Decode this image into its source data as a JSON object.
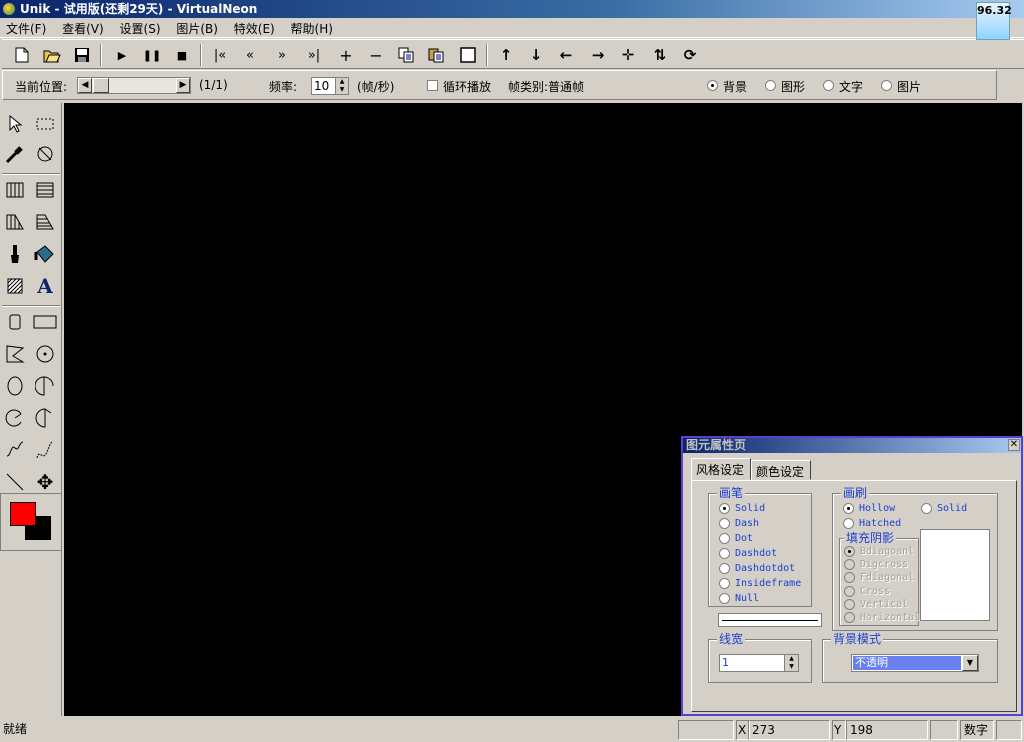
{
  "window": {
    "title": "Unik - 试用版(还剩29天) - VirtualNeon",
    "zoom_badge": "96.32"
  },
  "menu": [
    "文件(F)",
    "查看(V)",
    "设置(S)",
    "图片(B)",
    "特效(E)",
    "帮助(H)"
  ],
  "playbar": {
    "position_label": "当前位置:",
    "frame_count": "(1/1)",
    "rate_label": "频率:",
    "rate_value": "10",
    "rate_unit": "(帧/秒)",
    "loop_label": "循环播放",
    "frame_type": "帧类别:普通帧",
    "layers": [
      {
        "label": "背景",
        "selected": true
      },
      {
        "label": "图形",
        "selected": false
      },
      {
        "label": "文字",
        "selected": false
      },
      {
        "label": "图片",
        "selected": false
      }
    ]
  },
  "colors": {
    "foreground": "#ff0000",
    "background": "#000000",
    "canvas": "#000000"
  },
  "status": {
    "ready": "就绪",
    "x_label": "X",
    "x_value": "273",
    "y_label": "Y",
    "y_value": "198",
    "numlock": "数字"
  },
  "props": {
    "title": "图元属性页",
    "tabs": [
      "风格设定",
      "颜色设定"
    ],
    "pen": {
      "title": "画笔",
      "options": [
        "Solid",
        "Dash",
        "Dot",
        "Dashdot",
        "Dashdotdot",
        "Insideframe",
        "Null"
      ],
      "selected": "Solid"
    },
    "brush": {
      "title": "画刷",
      "options": [
        "Hollow",
        "Solid",
        "Hatched"
      ],
      "selected": "Hollow"
    },
    "hatch": {
      "title": "填充阴影",
      "options": [
        "Bdiagoanl",
        "Digcross",
        "Fdiagonal",
        "Cross",
        "Vertical",
        "Horizontal"
      ]
    },
    "line_width": {
      "title": "线宽",
      "value": "1"
    },
    "bg_mode": {
      "title": "背景模式",
      "value": "不透明"
    }
  }
}
